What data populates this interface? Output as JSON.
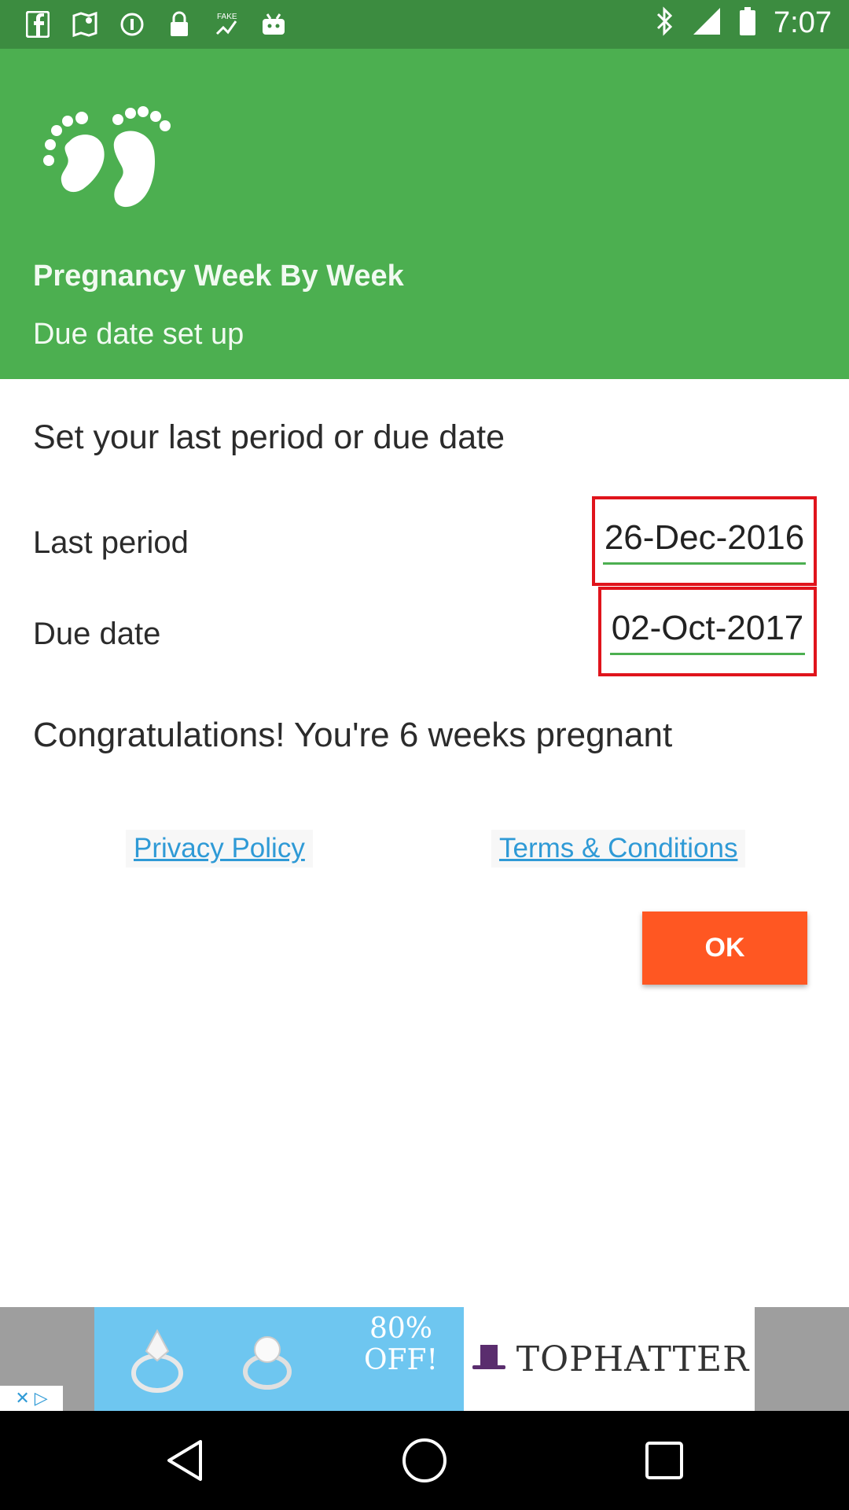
{
  "status_bar": {
    "time": "7:07",
    "left_icons": [
      "facebook-icon",
      "maps-icon",
      "info-icon",
      "lock-icon",
      "fake-gps-icon",
      "android-icon"
    ],
    "right_icons": [
      "bluetooth-icon",
      "signal-icon",
      "battery-icon"
    ]
  },
  "header": {
    "logo_icon": "footprints-icon",
    "title": "Pregnancy Week By Week",
    "subtitle": "Due date set up",
    "background_color": "#4caf50"
  },
  "form": {
    "instruction": "Set your last period or due date",
    "last_period_label": "Last period",
    "last_period_value": "26-Dec-2016",
    "due_date_label": "Due date",
    "due_date_value": "02-Oct-2017"
  },
  "message": {
    "congrats": "Congratulations! You're 6 weeks pregnant"
  },
  "links": {
    "privacy": "Privacy Policy",
    "terms": "Terms & Conditions"
  },
  "actions": {
    "ok_label": "OK",
    "ok_color": "#ff5722"
  },
  "ad": {
    "offer": "80% OFF!",
    "brand": "TOPHATTER",
    "icons": [
      "close-icon",
      "adchoices-icon"
    ]
  },
  "nav_bar": {
    "icons": [
      "back-icon",
      "home-icon",
      "recents-icon"
    ]
  }
}
